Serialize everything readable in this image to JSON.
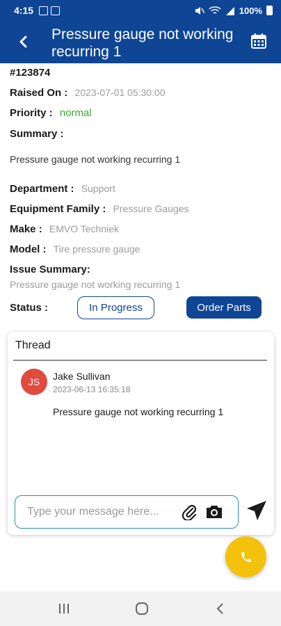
{
  "status_bar": {
    "time": "4:15",
    "battery": "100%"
  },
  "header": {
    "title": "Pressure gauge not working recurring 1"
  },
  "ticket": {
    "id": "#123874",
    "raised_on_label": "Raised On :",
    "raised_on": "2023-07-01 05:30:00",
    "priority_label": "Priority :",
    "priority": "normal",
    "summary_label": "Summary :",
    "summary": "Pressure gauge not working recurring 1",
    "department_label": "Department :",
    "department": "Support",
    "equipment_family_label": "Equipment Family :",
    "equipment_family": "Pressure Gauges",
    "make_label": "Make :",
    "make": "EMVO Techniek",
    "model_label": "Model :",
    "model": "Tire pressure gauge",
    "issue_summary_label": "Issue Summary:",
    "issue_summary": "Pressure gauge not working recurring 1",
    "status_label": "Status :",
    "status": "In Progress",
    "order_parts_label": "Order Parts"
  },
  "thread": {
    "title": "Thread",
    "messages": [
      {
        "initials": "JS",
        "author": "Jake Sullivan",
        "timestamp": "2023-06-13 16:35:18",
        "text": "Pressure gauge not working recurring 1"
      }
    ],
    "input_placeholder": "Type your message here..."
  },
  "colors": {
    "primary": "#0e4595",
    "priority_normal": "#43a83a",
    "avatar": "#e04a3f",
    "fab": "#f4c20d",
    "input_border": "#2a8fb0"
  },
  "icons": {
    "back": "arrow-left-icon",
    "calendar": "calendar-icon",
    "attach": "paperclip-icon",
    "camera": "camera-icon",
    "send": "send-icon",
    "call": "phone-icon"
  }
}
